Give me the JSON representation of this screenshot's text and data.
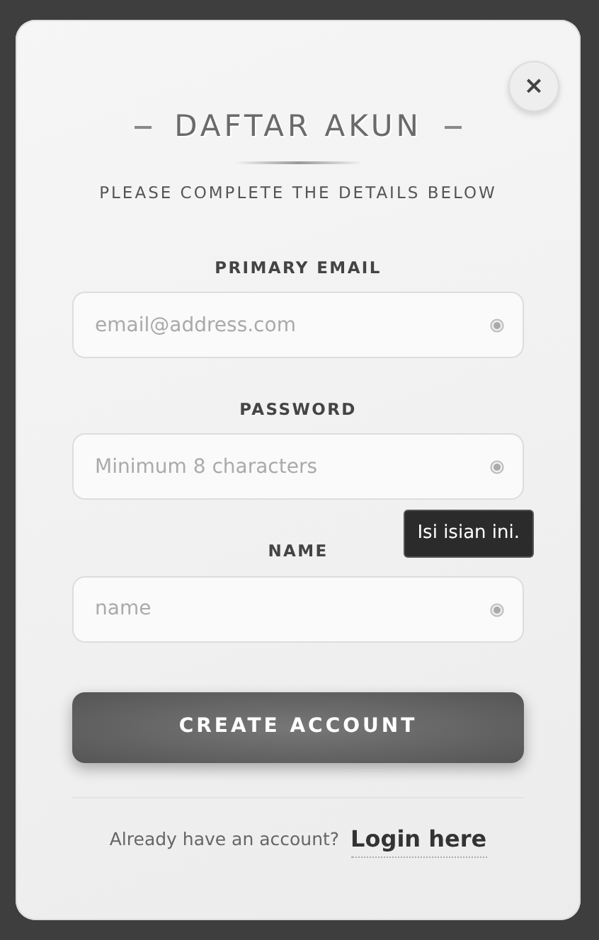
{
  "close_button": "×",
  "title": "DAFTAR AKUN",
  "subtitle": "PLEASE COMPLETE THE DETAILS BELOW",
  "fields": [
    {
      "label": "PRIMARY EMAIL",
      "placeholder": "email@address.com"
    },
    {
      "label": "PASSWORD",
      "placeholder": "Minimum 8 characters"
    },
    {
      "label": "NAME",
      "placeholder": "name",
      "tooltip": "Isi isian ini."
    }
  ],
  "submit": "CREATE ACCOUNT",
  "footer": {
    "text": "Already have an account?",
    "link": "Login here"
  }
}
